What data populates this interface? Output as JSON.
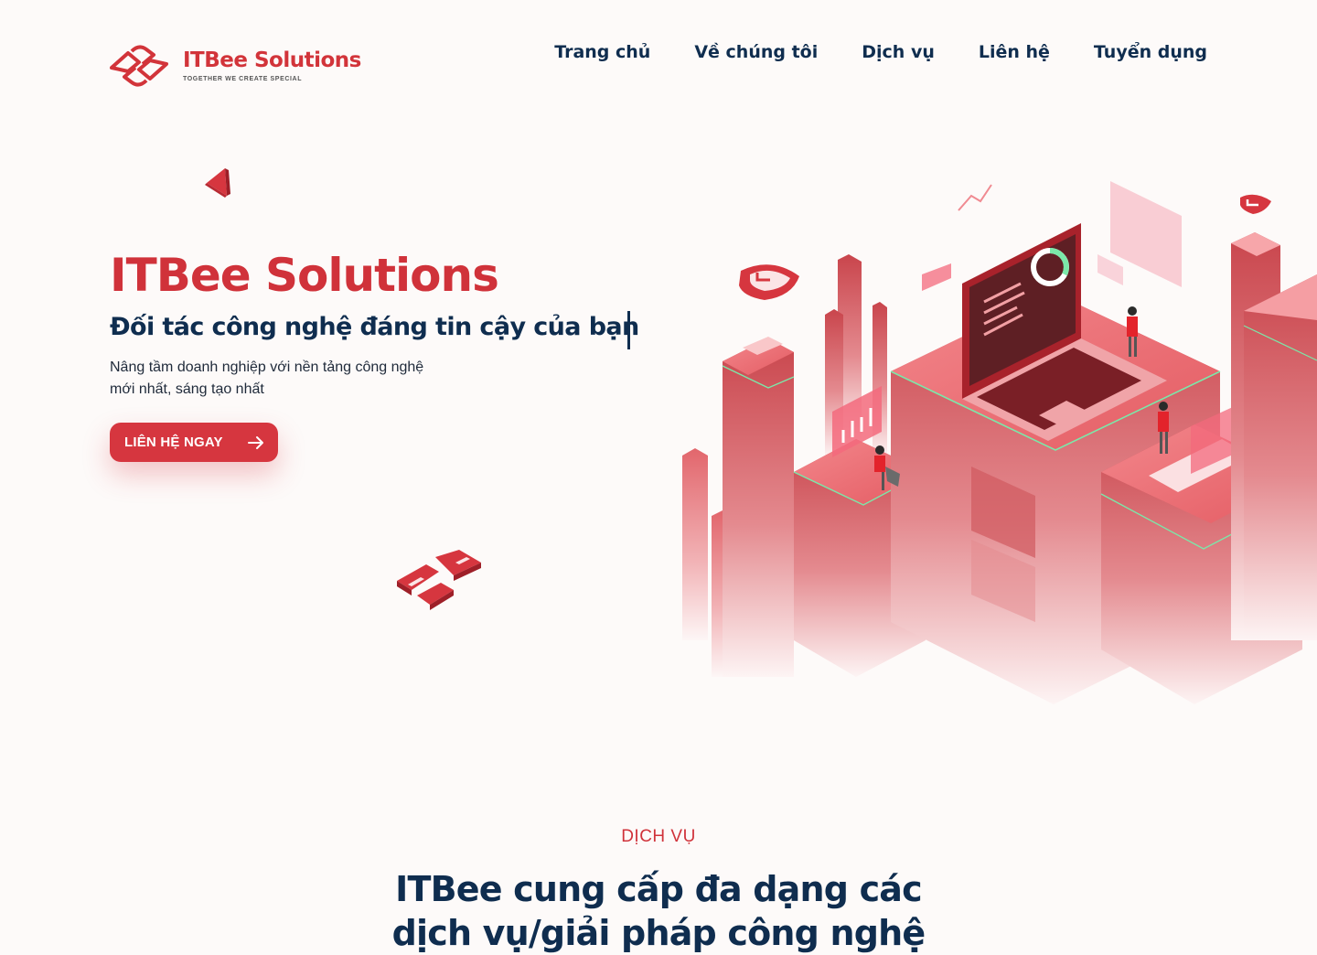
{
  "brand": {
    "name": "ITBee Solutions",
    "tagline": "TOGETHER WE CREATE SPECIAL",
    "primary_color": "#d2343a",
    "navy_color": "#0f2d4f"
  },
  "nav": {
    "items": [
      {
        "label": "Trang chủ"
      },
      {
        "label": "Về chúng tôi"
      },
      {
        "label": "Dịch vụ"
      },
      {
        "label": "Liên hệ"
      },
      {
        "label": "Tuyển dụng"
      }
    ]
  },
  "hero": {
    "title": "ITBee Solutions",
    "subtitle": "Đối tác công nghệ đáng tin cậy của bạn",
    "description_lines": [
      "Nâng tầm doanh nghiệp với nền tảng công nghệ",
      "mới nhất, sáng tạo nhất"
    ],
    "cta_label": "LIÊN HỆ NGAY",
    "cta_icon": "arrow-right-icon",
    "illustration": "isometric-tech-city-illustration"
  },
  "services": {
    "kicker": "DỊCH VỤ",
    "title_lines": [
      "ITBee cung cấp đa dạng các",
      "dịch vụ/giải pháp công nghệ"
    ]
  }
}
